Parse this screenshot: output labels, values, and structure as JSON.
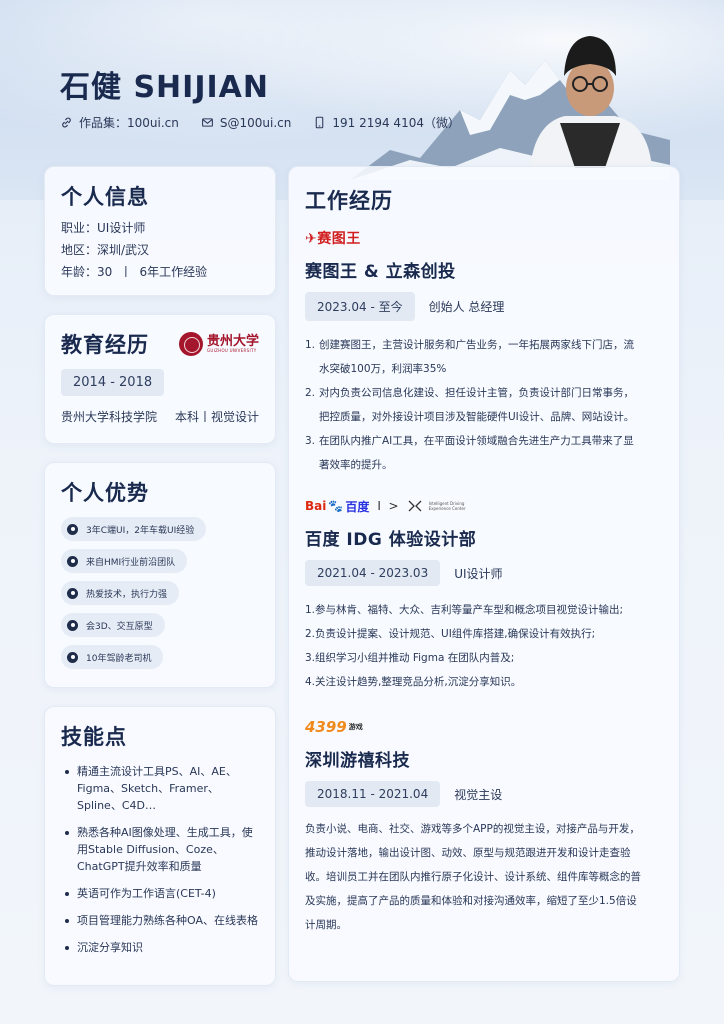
{
  "header": {
    "name": "石健 SHIJIAN",
    "contacts": [
      {
        "icon": "link-icon",
        "text": "作品集：100ui.cn"
      },
      {
        "icon": "mail-icon",
        "text": "S@100ui.cn"
      },
      {
        "icon": "phone-icon",
        "text": "191 2194 4104（微）"
      }
    ]
  },
  "info": {
    "title": "个人信息",
    "lines": [
      "职业：UI设计师",
      "地区：深圳/武汉",
      "年龄：30  丨  6年工作经验"
    ]
  },
  "education": {
    "title": "教育经历",
    "logo_text": "贵州大学",
    "logo_sub": "GUIZHOU UNIVERSITY",
    "date": "2014 - 2018",
    "school": "贵州大学科技学院",
    "degree": "本科丨视觉设计"
  },
  "advantages": {
    "title": "个人优势",
    "items": [
      "3年C端UI，2年车载UI经验",
      "来自HMI行业前沿团队",
      "热爱技术，执行力强",
      "会3D、交互原型",
      "10年驾龄老司机"
    ]
  },
  "skills": {
    "title": "技能点",
    "items": [
      "精通主流设计工具PS、AI、AE、Figma、Sketch、Framer、Spline、C4D…",
      "熟悉各种AI图像处理、生成工具，使用Stable Diffusion、Coze、ChatGPT提升效率和质量",
      "英语可作为工作语言(CET-4)",
      "项目管理能力熟练各种OA、在线表格",
      "沉淀分享知识"
    ]
  },
  "work": {
    "title": "工作经历",
    "jobs": [
      {
        "logo": "赛图王",
        "company": "赛图王 & 立森创投",
        "date": "2023.04 - 至今",
        "role": "创始人 总经理",
        "duties": [
          {
            "num": "1.",
            "line1": "创建赛图王，主营设计服务和广告业务，一年拓展两家线下门店，流",
            "line2": "水突破100万，利润率35%"
          },
          {
            "num": "2.",
            "line1": "对内负责公司信息化建设、担任设计主管，负责设计部门日常事务，",
            "line2": "把控质量，对外接设计项目涉及智能硬件UI设计、品牌、网站设计。"
          },
          {
            "num": "3.",
            "line1": "在团队内推广AI工具，在平面设计领域融合先进生产力工具带来了显",
            "line2": "著效率的提升。"
          }
        ]
      },
      {
        "logo_baidu_a": "Bai",
        "logo_baidu_b": "du",
        "logo_baidu_c": "百度",
        "logo_sep": "I  >",
        "logo_idg": "Intelligent Driving Experience Center",
        "company": "百度 IDG 体验设计部",
        "date": "2021.04 - 2023.03",
        "role": "UI设计师",
        "duties": [
          "1.参与林肯、福特、大众、吉利等量产车型和概念项目视觉设计输出;",
          "2.负责设计提案、设计规范、UI组件库搭建,确保设计有效执行;",
          "3.组织学习小组并推动 Figma 在团队内普及;",
          "4.关注设计趋势,整理竞品分析,沉淀分享知识。"
        ]
      },
      {
        "logo": "4399",
        "logo_sub": "游戏",
        "company": "深圳游禧科技",
        "date": "2018.11 - 2021.04",
        "role": "视觉主设",
        "lines": [
          "负责小说、电商、社交、游戏等多个APP的视觉主设，对接产品与开发，",
          "推动设计落地，输出设计图、动效、原型与规范跟进开发和设计走查验",
          "收。培训员工并在团队内推行原子化设计、设计系统、组件库等概念的普",
          "及实施，提高了产品的质量和体验和对接沟通效率，缩短了至少1.5倍设",
          "计周期。"
        ]
      }
    ]
  }
}
